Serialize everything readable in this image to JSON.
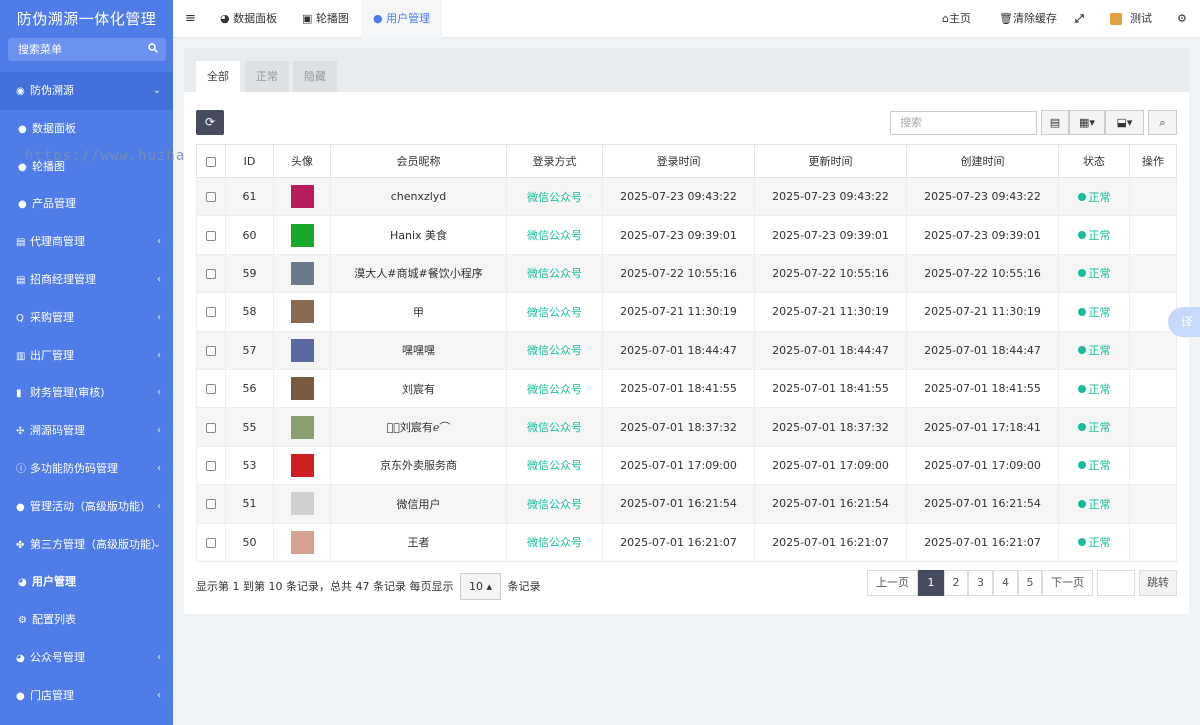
{
  "app": {
    "title": "防伪溯源一体化管理"
  },
  "search": {
    "placeholder": "搜索菜单"
  },
  "sidebar": {
    "items": [
      {
        "label": "防伪溯源",
        "icon": "globe-icon",
        "arrow": "chevron-down-icon"
      },
      {
        "label": "数据面板",
        "icon": "circle-icon",
        "arrow": ""
      },
      {
        "label": "轮播图",
        "icon": "circle-icon",
        "arrow": ""
      },
      {
        "label": "产品管理",
        "icon": "circle-icon",
        "arrow": ""
      },
      {
        "label": "代理商管理",
        "icon": "id-card-icon",
        "arrow": "chevron-left-icon"
      },
      {
        "label": "招商经理管理",
        "icon": "id-card-icon",
        "arrow": "chevron-left-icon"
      },
      {
        "label": "采购管理",
        "icon": "search-icon",
        "arrow": "chevron-left-icon"
      },
      {
        "label": "出厂管理",
        "icon": "truck-icon",
        "arrow": "chevron-left-icon"
      },
      {
        "label": "财务管理(审核)",
        "icon": "money-icon",
        "arrow": "chevron-left-icon"
      },
      {
        "label": "溯源码管理",
        "icon": "users-icon",
        "arrow": "chevron-left-icon"
      },
      {
        "label": "多功能防伪码管理",
        "icon": "info-icon",
        "arrow": "chevron-left-icon"
      },
      {
        "label": "管理活动（高级版功能）",
        "icon": "circle-icon",
        "arrow": "chevron-left-icon"
      },
      {
        "label": "第三方管理（高级版功能）",
        "icon": "puzzle-icon",
        "arrow": "chevron-down-icon"
      },
      {
        "label": "用户管理",
        "icon": "wechat-icon",
        "arrow": ""
      },
      {
        "label": "配置列表",
        "icon": "gear-icon",
        "arrow": ""
      },
      {
        "label": "公众号管理",
        "icon": "wechat-icon",
        "arrow": "chevron-left-icon"
      },
      {
        "label": "门店管理",
        "icon": "circle-icon",
        "arrow": "chevron-left-icon"
      }
    ]
  },
  "topbar": {
    "menu_icon": "≡",
    "tabs": [
      {
        "label": "数据面板",
        "icon": "dashboard-icon"
      },
      {
        "label": "轮播图",
        "icon": "image-icon"
      },
      {
        "label": "用户管理",
        "icon": "wechat-icon"
      }
    ],
    "home": "主页",
    "clear_cache": "清除缓存",
    "user": "测试"
  },
  "watermark": "https://www.huzhan.com/ishop4000",
  "content": {
    "tabs": [
      "全部",
      "正常",
      "隐藏"
    ],
    "search_placeholder": "搜索",
    "columns": [
      "ID",
      "头像",
      "会员昵称",
      "登录方式",
      "登录时间",
      "更新时间",
      "创建时间",
      "状态",
      "操作"
    ],
    "rows": [
      {
        "id": "61",
        "nick": "chenxzlyd",
        "login": "微信公众号",
        "login_time": "2025-07-23 09:43:22",
        "update_time": "2025-07-23 09:43:22",
        "create_time": "2025-07-23 09:43:22",
        "status": "正常"
      },
      {
        "id": "60",
        "nick": "Hanix 美食",
        "login": "微信公众号",
        "login_time": "2025-07-23 09:39:01",
        "update_time": "2025-07-23 09:39:01",
        "create_time": "2025-07-23 09:39:01",
        "status": "正常"
      },
      {
        "id": "59",
        "nick": "漠大人#商城#餐饮小程序",
        "login": "微信公众号",
        "login_time": "2025-07-22 10:55:16",
        "update_time": "2025-07-22 10:55:16",
        "create_time": "2025-07-22 10:55:16",
        "status": "正常"
      },
      {
        "id": "58",
        "nick": "甲",
        "login": "微信公众号",
        "login_time": "2025-07-21 11:30:19",
        "update_time": "2025-07-21 11:30:19",
        "create_time": "2025-07-21 11:30:19",
        "status": "正常"
      },
      {
        "id": "57",
        "nick": "嘿嘿嘿",
        "login": "微信公众号",
        "login_time": "2025-07-01 18:44:47",
        "update_time": "2025-07-01 18:44:47",
        "create_time": "2025-07-01 18:44:47",
        "status": "正常"
      },
      {
        "id": "56",
        "nick": "刘宸有",
        "login": "微信公众号",
        "login_time": "2025-07-01 18:41:55",
        "update_time": "2025-07-01 18:41:55",
        "create_time": "2025-07-01 18:41:55",
        "status": "正常"
      },
      {
        "id": "55",
        "nick": "🖎ꪳ刘宸有ℯ⌒",
        "login": "微信公众号",
        "login_time": "2025-07-01 18:37:32",
        "update_time": "2025-07-01 18:37:32",
        "create_time": "2025-07-01 17:18:41",
        "status": "正常"
      },
      {
        "id": "53",
        "nick": "京东外卖服务商",
        "login": "微信公众号",
        "login_time": "2025-07-01 17:09:00",
        "update_time": "2025-07-01 17:09:00",
        "create_time": "2025-07-01 17:09:00",
        "status": "正常"
      },
      {
        "id": "51",
        "nick": "微信用户",
        "login": "微信公众号",
        "login_time": "2025-07-01 16:21:54",
        "update_time": "2025-07-01 16:21:54",
        "create_time": "2025-07-01 16:21:54",
        "status": "正常"
      },
      {
        "id": "50",
        "nick": "王者",
        "login": "微信公众号",
        "login_time": "2025-07-01 16:21:07",
        "update_time": "2025-07-01 16:21:07",
        "create_time": "2025-07-01 16:21:07",
        "status": "正常"
      }
    ],
    "avatar_colors": [
      "#b71c5c",
      "#1aa82a",
      "#6a7a8a",
      "#8a6a50",
      "#5a6aa0",
      "#7a5a40",
      "#8aa070",
      "#cc2222",
      "#d0d0d0",
      "#d8a090"
    ],
    "pager": {
      "info_pre": "显示第 1 到第 10 条记录，总共 47 条记录 每页显示",
      "page_size": "10",
      "info_post": "条记录",
      "prev": "上一页",
      "pages": [
        "1",
        "2",
        "3",
        "4",
        "5"
      ],
      "next": "下一页",
      "jump": "跳转"
    },
    "translate": "译"
  }
}
